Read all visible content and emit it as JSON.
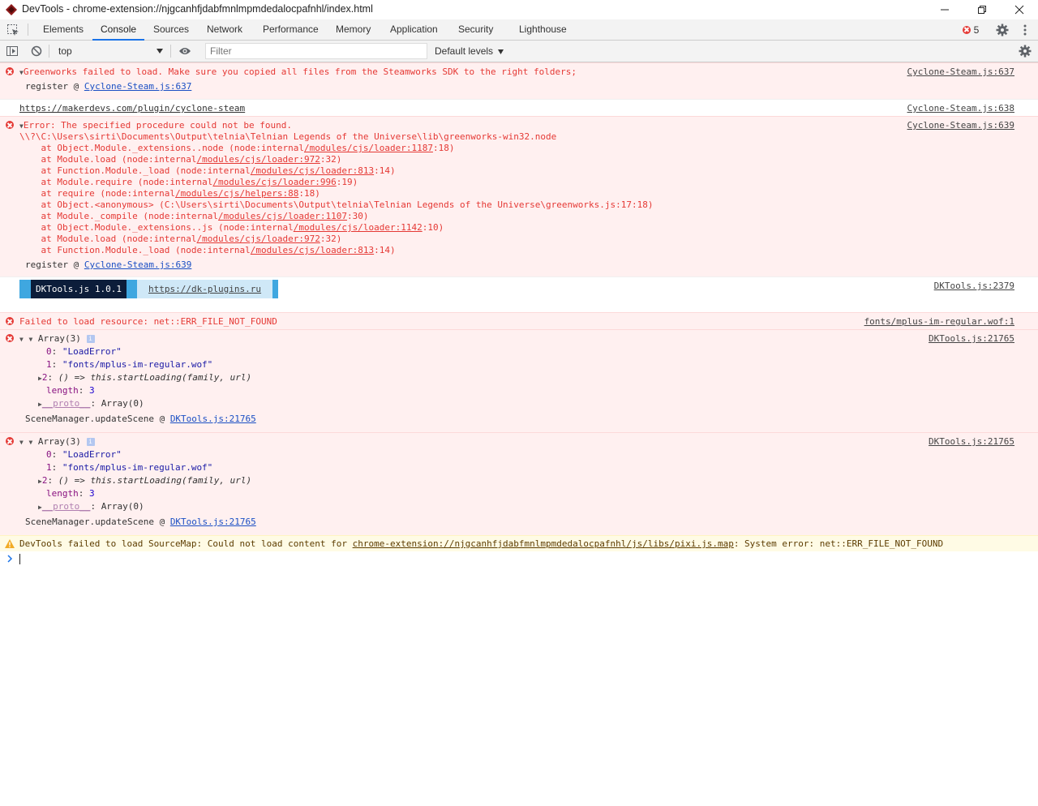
{
  "window": {
    "title": "DevTools - chrome-extension://njgcanhfjdabfmnlmpmdedalocpafnhl/index.html"
  },
  "tabs": [
    {
      "label": "Elements"
    },
    {
      "label": "Console",
      "active": true
    },
    {
      "label": "Sources"
    },
    {
      "label": "Network"
    },
    {
      "label": "Performance"
    },
    {
      "label": "Memory"
    },
    {
      "label": "Application"
    },
    {
      "label": "Security"
    },
    {
      "label": "Lighthouse"
    }
  ],
  "error_count": "5",
  "console_toolbar": {
    "context": "top",
    "filter_placeholder": "Filter",
    "levels": "Default levels"
  },
  "messages": {
    "m1": {
      "text": "Greenworks failed to load. Make sure you copied all files from the Steamworks SDK to the right folders;",
      "source": "Cyclone-Steam.js:637",
      "trace_fn": "register @ ",
      "trace_link": "Cyclone-Steam.js:637"
    },
    "m2": {
      "text": "https://makerdevs.com/plugin/cyclone-steam",
      "source": "Cyclone-Steam.js:638"
    },
    "m3": {
      "text": "Error: The specified procedure could not be found.",
      "path": "\\\\?\\C:\\Users\\sirti\\Documents\\Output\\telnia\\Telnian Legends of the Universe\\lib\\greenworks-win32.node",
      "stack": [
        {
          "pre": "    at Object.Module._extensions..node (node:internal",
          "link": "/modules/cjs/loader:1187",
          "post": ":18)"
        },
        {
          "pre": "    at Module.load (node:internal",
          "link": "/modules/cjs/loader:972",
          "post": ":32)"
        },
        {
          "pre": "    at Function.Module._load (node:internal",
          "link": "/modules/cjs/loader:813",
          "post": ":14)"
        },
        {
          "pre": "    at Module.require (node:internal",
          "link": "/modules/cjs/loader:996",
          "post": ":19)"
        },
        {
          "pre": "    at require (node:internal",
          "link": "/modules/cjs/helpers:88",
          "post": ":18)"
        },
        {
          "pre": "    at Object.<anonymous> (C:\\Users\\sirti\\Documents\\Output\\telnia\\Telnian Legends of the Universe\\greenworks.js:17:18)",
          "link": "",
          "post": ""
        },
        {
          "pre": "    at Module._compile (node:internal",
          "link": "/modules/cjs/loader:1107",
          "post": ":30)"
        },
        {
          "pre": "    at Object.Module._extensions..js (node:internal",
          "link": "/modules/cjs/loader:1142",
          "post": ":10)"
        },
        {
          "pre": "    at Module.load (node:internal",
          "link": "/modules/cjs/loader:972",
          "post": ":32)"
        },
        {
          "pre": "    at Function.Module._load (node:internal",
          "link": "/modules/cjs/loader:813",
          "post": ":14)"
        }
      ],
      "source": "Cyclone-Steam.js:639",
      "trace_fn": "register @ ",
      "trace_link": "Cyclone-Steam.js:639"
    },
    "m4": {
      "name": "DKTools.js 1.0.1",
      "url": "https://dk-plugins.ru",
      "source": "DKTools.js:2379"
    },
    "m5": {
      "text": "Failed to load resource: net::ERR_FILE_NOT_FOUND",
      "source": "fonts/mplus-im-regular.wof:1"
    },
    "m6": {
      "header": "Array(3)",
      "k0": "0",
      "v0": "\"LoadError\"",
      "k1": "1",
      "v1": "\"fonts/mplus-im-regular.wof\"",
      "k2": "2",
      "v2": "() => this.startLoading(family, url)",
      "klen": "length",
      "vlen": "3",
      "kproto": "__proto__",
      "vproto": "Array(0)",
      "trace_fn": "SceneManager.updateScene @ ",
      "trace_link": "DKTools.js:21765",
      "source": "DKTools.js:21765"
    },
    "m7": {
      "header": "Array(3)",
      "k0": "0",
      "v0": "\"LoadError\"",
      "k1": "1",
      "v1": "\"fonts/mplus-im-regular.wof\"",
      "k2": "2",
      "v2": "() => this.startLoading(family, url)",
      "klen": "length",
      "vlen": "3",
      "kproto": "__proto__",
      "vproto": "Array(0)",
      "trace_fn": "SceneManager.updateScene @ ",
      "trace_link": "DKTools.js:21765",
      "source": "DKTools.js:21765"
    },
    "m8": {
      "pre": "DevTools failed to load SourceMap: Could not load content for ",
      "link": "chrome-extension://njgcanhfjdabfmnlmpmdedalocpafnhl/js/libs/pixi.js.map",
      "post": ": System error: net::ERR_FILE_NOT_FOUND"
    }
  },
  "colors": {
    "error": "#e53935",
    "accent": "#1a73e8",
    "error_bg": "#fff0f0",
    "warn_bg": "#fffbe5"
  }
}
